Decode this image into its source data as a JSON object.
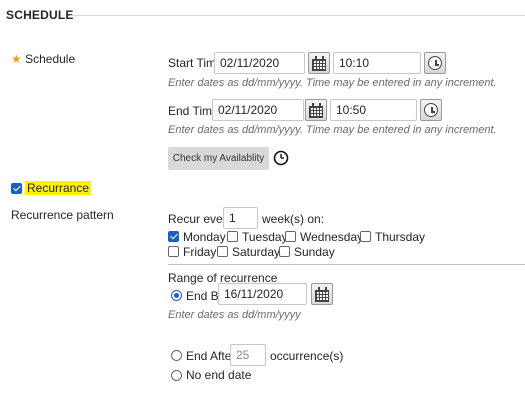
{
  "section": {
    "title": "SCHEDULE"
  },
  "schedule": {
    "required_label": "Schedule",
    "start_time_label": "Start Time",
    "start_date": "02/11/2020",
    "start_time": "10:10",
    "end_time_label": "End Time",
    "end_date": "02/11/2020",
    "end_time": "10:50",
    "hint": "Enter dates as dd/mm/yyyy. Time may be entered in any increment.",
    "availability_button": "Check my Availablity"
  },
  "recurrence": {
    "checkbox_label": "Recurrance",
    "checked": true,
    "pattern_label": "Recurrence pattern",
    "recur_every_label": "Recur every",
    "recur_every_value": "1",
    "weeks_on_label": "week(s) on:",
    "days": [
      {
        "label": "Monday",
        "checked": true
      },
      {
        "label": "Tuesday",
        "checked": false
      },
      {
        "label": "Wednesday",
        "checked": false
      },
      {
        "label": "Thursday",
        "checked": false
      },
      {
        "label": "Friday",
        "checked": false
      },
      {
        "label": "Saturday",
        "checked": false
      },
      {
        "label": "Sunday",
        "checked": false
      }
    ],
    "range_label": "Range of recurrence",
    "end_by_label": "End By",
    "end_by_date": "16/11/2020",
    "end_by_selected": true,
    "date_hint": "Enter dates as dd/mm/yyyy",
    "end_after_label": "End After",
    "end_after_value": "25",
    "occurrences_label": "occurrence(s)",
    "no_end_label": "No end date"
  },
  "colors": {
    "accent": "#1a5fc2",
    "highlight": "#fff200",
    "required_star": "#f0a020"
  }
}
